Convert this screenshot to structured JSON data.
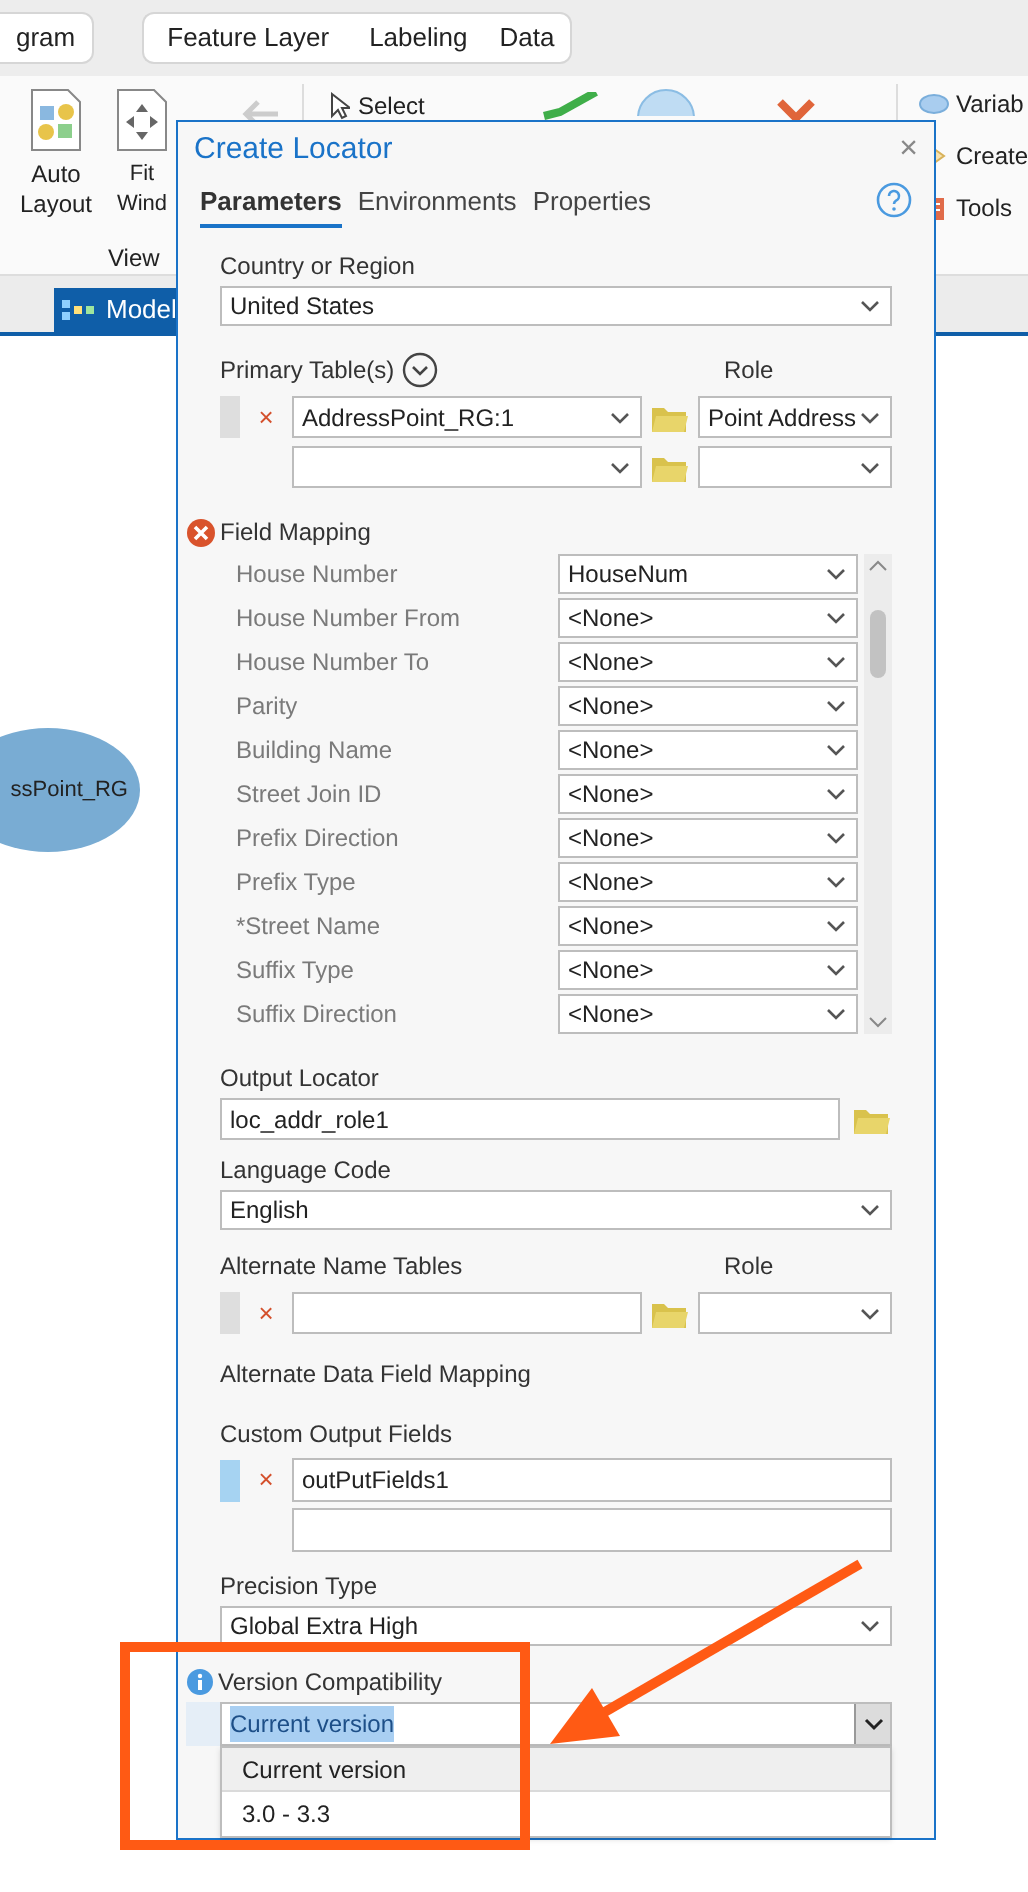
{
  "app": {
    "ribbon_tabs": [
      {
        "label": "gram",
        "selected": false
      },
      {
        "label": "Feature Layer",
        "selected": false
      },
      {
        "label": "Labeling",
        "selected": false
      },
      {
        "label": "Data",
        "selected": false
      }
    ],
    "view_buttons": [
      "Auto Layout",
      "Fit Wind"
    ],
    "view_group": "View",
    "select_label": "Select",
    "right_items": [
      "Variab",
      "Create",
      "Tools"
    ],
    "view_tab": "Model",
    "node_label": "ssPoint_RG"
  },
  "dialog": {
    "title": "Create Locator",
    "close_glyph": "×",
    "remove_glyph": "×",
    "tabs": [
      {
        "label": "Parameters",
        "selected": true
      },
      {
        "label": "Environments",
        "selected": false
      },
      {
        "label": "Properties",
        "selected": false
      }
    ],
    "parameters": [
      {
        "kind": "select",
        "label": "Country or Region",
        "value": "United States"
      },
      {
        "kind": "table_list",
        "label": "Primary Table(s)",
        "role_label": "Role",
        "has_options": true,
        "rows": [
          {
            "table": "AddressPoint_RG:1",
            "role": "Point Address",
            "text_entry": false
          },
          {
            "table": "",
            "role": "",
            "text_entry": false
          }
        ]
      },
      {
        "kind": "field_mapping",
        "label": "Field Mapping",
        "error": true,
        "rows": [
          {
            "field": "House Number",
            "value": "HouseNum"
          },
          {
            "field": "House Number From",
            "value": "<None>"
          },
          {
            "field": "House Number To",
            "value": "<None>"
          },
          {
            "field": "Parity",
            "value": "<None>"
          },
          {
            "field": "Building Name",
            "value": "<None>"
          },
          {
            "field": "Street Join ID",
            "value": "<None>"
          },
          {
            "field": "Prefix Direction",
            "value": "<None>"
          },
          {
            "field": "Prefix Type",
            "value": "<None>"
          },
          {
            "field": "*Street Name",
            "value": "<None>"
          },
          {
            "field": "Suffix Type",
            "value": "<None>"
          },
          {
            "field": "Suffix Direction",
            "value": "<None>"
          }
        ]
      },
      {
        "kind": "file",
        "label": "Output Locator",
        "value": "loc_addr_role1"
      },
      {
        "kind": "select",
        "label": "Language Code",
        "value": "English"
      },
      {
        "kind": "table_list",
        "label": "Alternate Name Tables",
        "role_label": "Role",
        "has_options": false,
        "rows": [
          {
            "table": "",
            "role": "",
            "text_entry": true
          }
        ]
      },
      {
        "kind": "heading",
        "label": "Alternate Data Field Mapping"
      },
      {
        "kind": "value_list",
        "label": "Custom Output Fields",
        "values": [
          "outPutFields1"
        ]
      },
      {
        "kind": "select",
        "label": "Precision Type",
        "value": "Global Extra High"
      },
      {
        "kind": "open_select",
        "label": "Version Compatibility",
        "info": true,
        "value": "Current version",
        "expanded": true,
        "options": [
          {
            "label": "Current version",
            "selected": true
          },
          {
            "label": "3.0 - 3.3",
            "selected": false
          }
        ]
      }
    ]
  }
}
